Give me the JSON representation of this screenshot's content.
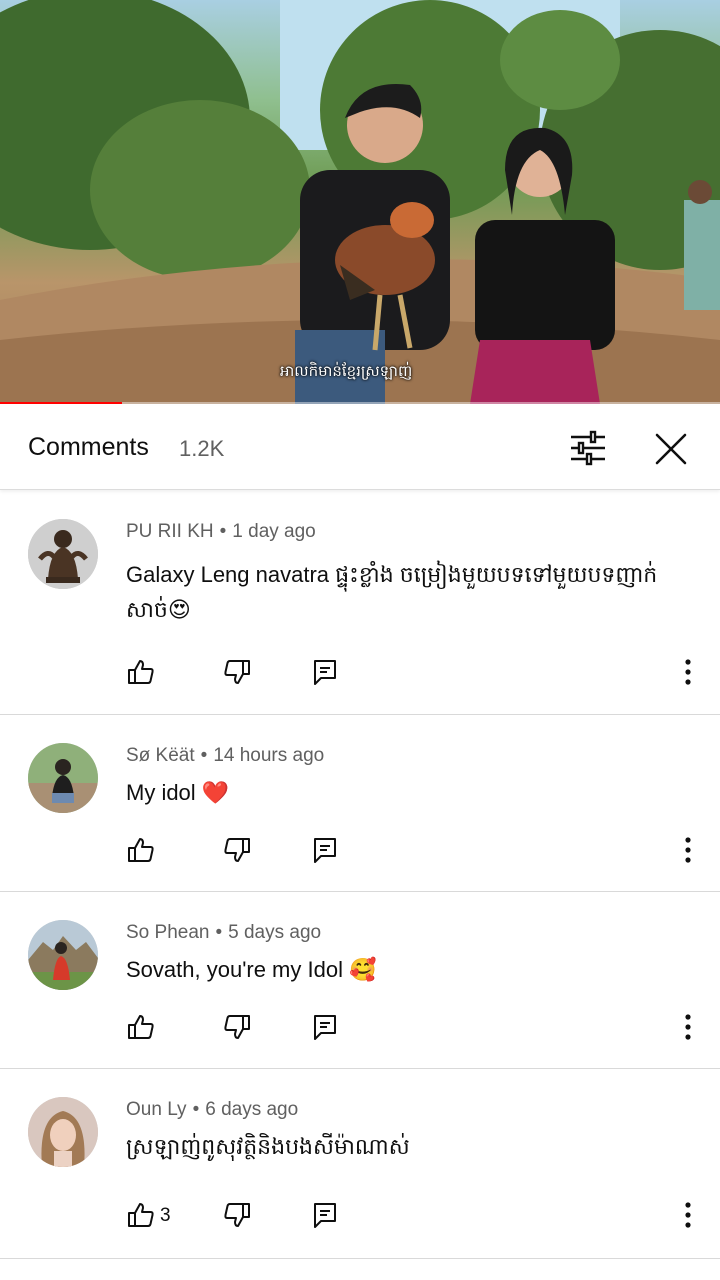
{
  "video": {
    "caption": "អាលកិមាន់ខ្មែរស្រឡាញ់",
    "progress": 0.17
  },
  "comments_header": {
    "title": "Comments",
    "count": "1.2K"
  },
  "comments": [
    {
      "author": "PU RII KH",
      "time": "1 day ago",
      "text": "Galaxy Leng navatra ផ្ទុះខ្លាំង ចម្រៀងមួយបទទៅមួយបទញាក់សាច់😍",
      "likes": ""
    },
    {
      "author": "Sø Këät",
      "time": "14 hours ago",
      "text": "My idol ❤️",
      "likes": ""
    },
    {
      "author": "So Phean",
      "time": "5 days ago",
      "text": "Sovath, you're my Idol 🥰",
      "likes": ""
    },
    {
      "author": "Oun Ly",
      "time": "6 days ago",
      "text": "ស្រឡាញ់ពូសុវត្ថិនិងបងសីម៉ាណាស់",
      "likes": "3"
    }
  ],
  "icons": {
    "filter": "sliders-icon",
    "close": "close-icon",
    "like": "thumbs-up-icon",
    "dislike": "thumbs-down-icon",
    "reply": "reply-icon",
    "more": "more-vertical-icon"
  },
  "colors": {
    "progress": "#ff0000",
    "secondary_text": "#606060",
    "divider": "#d9d9d9"
  }
}
